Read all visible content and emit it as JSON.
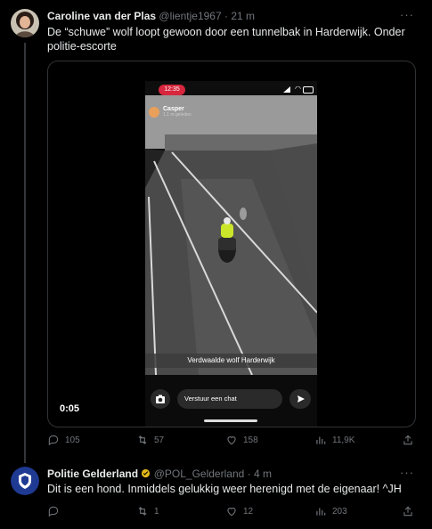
{
  "tweet1": {
    "name": "Caroline van der Plas",
    "handle": "@lientje1967",
    "separator": "·",
    "time": "21 m",
    "text": "De “schuwe” wolf loopt gewoon door een tunnelbak in Harderwijk. Onder politie-escorte",
    "more": "···",
    "video": {
      "status_time": "12:35",
      "story_user": "Casper",
      "story_time": "1.1 m geleden",
      "caption": "Verdwaalde wolf Harderwijk",
      "chat_placeholder": "Verstuur een chat",
      "duration": "0:05"
    },
    "actions": {
      "replies": "105",
      "retweets": "57",
      "likes": "158",
      "views": "11,9K"
    }
  },
  "tweet2": {
    "name": "Politie Gelderland",
    "handle": "@POL_Gelderland",
    "separator": "·",
    "time": "4 m",
    "text": "Dit is een hond. Inmiddels gelukkig weer herenigd met de eigenaar! ^JH",
    "more": "···",
    "actions": {
      "replies": "",
      "retweets": "1",
      "likes": "12",
      "views": "203"
    }
  },
  "colors": {
    "background": "#000000",
    "text": "#e7e9ea",
    "muted": "#71767b",
    "divider": "#2f3336",
    "police_blue": "#1f3a93",
    "verified_gold": "#e2b719",
    "recording_red": "#d7263d"
  }
}
